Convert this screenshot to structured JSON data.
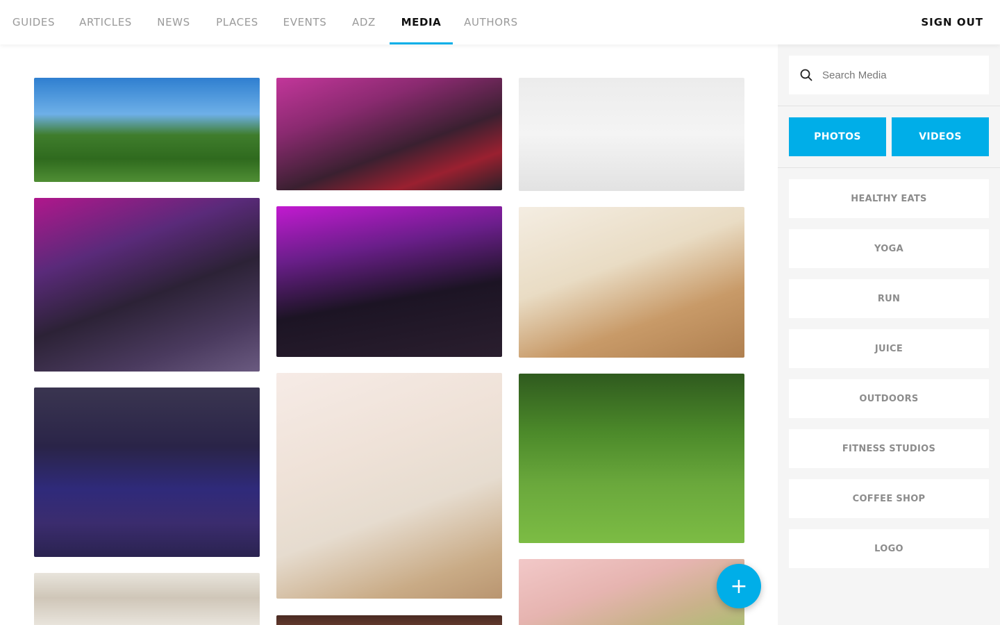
{
  "nav": {
    "tabs": [
      {
        "label": "GUIDES"
      },
      {
        "label": "ARTICLES"
      },
      {
        "label": "NEWS"
      },
      {
        "label": "PLACES"
      },
      {
        "label": "EVENTS"
      },
      {
        "label": "ADZ"
      },
      {
        "label": "MEDIA",
        "active": true
      },
      {
        "label": "AUTHORS"
      }
    ],
    "sign_out": "SIGN OUT"
  },
  "search": {
    "placeholder": "Search Media",
    "value": ""
  },
  "media_types": {
    "photos": "PHOTOS",
    "videos": "VIDEOS"
  },
  "categories": [
    "HEALTHY EATS",
    "YOGA",
    "RUN",
    "JUICE",
    "OUTDOORS",
    "FITNESS STUDIOS",
    "COFFEE SHOP",
    "LOGO"
  ],
  "fab": {
    "icon": "plus-icon",
    "symbol": "+"
  },
  "colors": {
    "accent": "#00aee8"
  }
}
